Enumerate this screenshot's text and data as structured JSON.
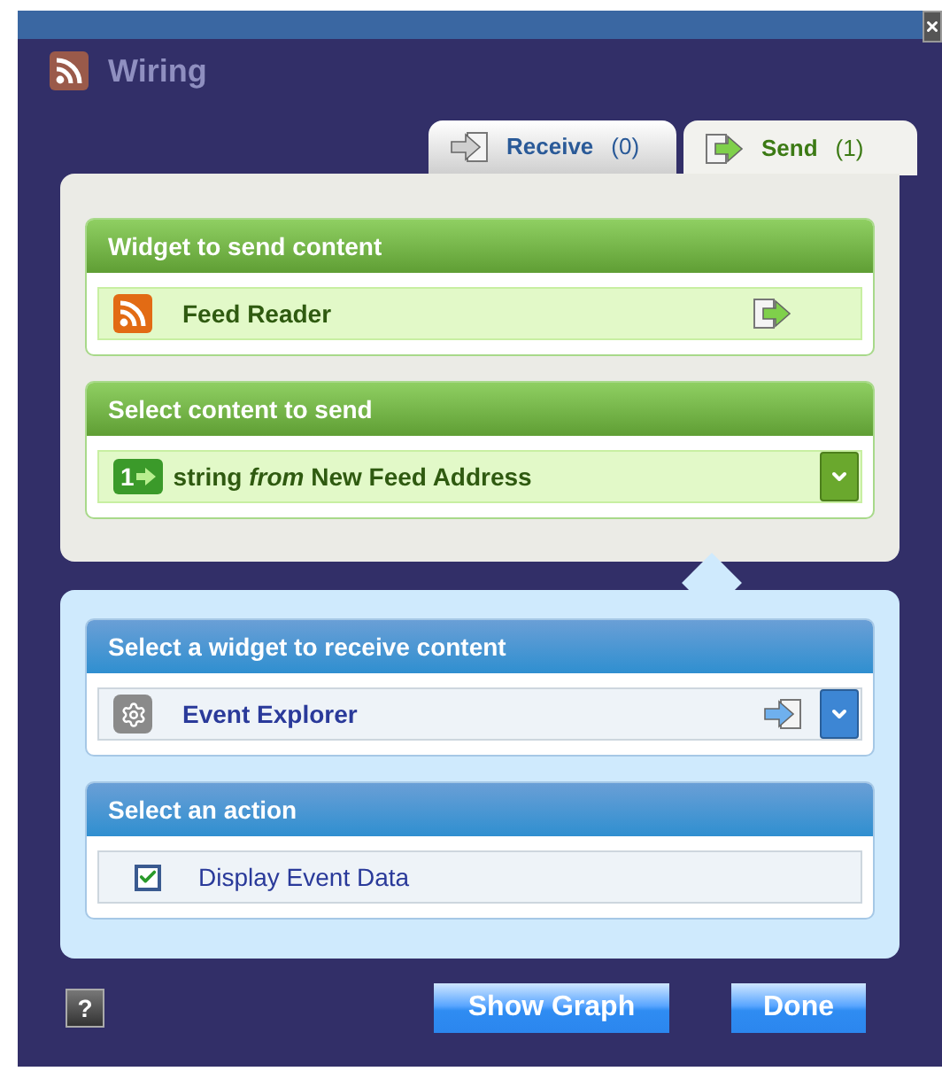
{
  "window": {
    "title": "Wiring",
    "help": "?"
  },
  "tabs": [
    {
      "kind": "receive",
      "label": "Receive",
      "count": "(0)",
      "selected": false
    },
    {
      "kind": "send",
      "label": "Send",
      "count": "(1)",
      "selected": true
    }
  ],
  "send_panel": {
    "sections": [
      {
        "kind": "widget",
        "title": "Widget to send content",
        "row": {
          "name": "Feed Reader"
        }
      },
      {
        "kind": "content",
        "title": "Select content to send",
        "row": {
          "badge": "1",
          "text": "string *from* New Feed Address"
        }
      }
    ]
  },
  "receive_panel": {
    "sections": [
      {
        "kind": "widget",
        "title": "Select a widget to receive content",
        "row": {
          "name": "Event Explorer"
        }
      },
      {
        "kind": "action",
        "title": "Select an action",
        "row": {
          "label": "Display Event Data",
          "checked": true
        }
      }
    ]
  },
  "buttons": [
    "Show Graph",
    "Done"
  ]
}
